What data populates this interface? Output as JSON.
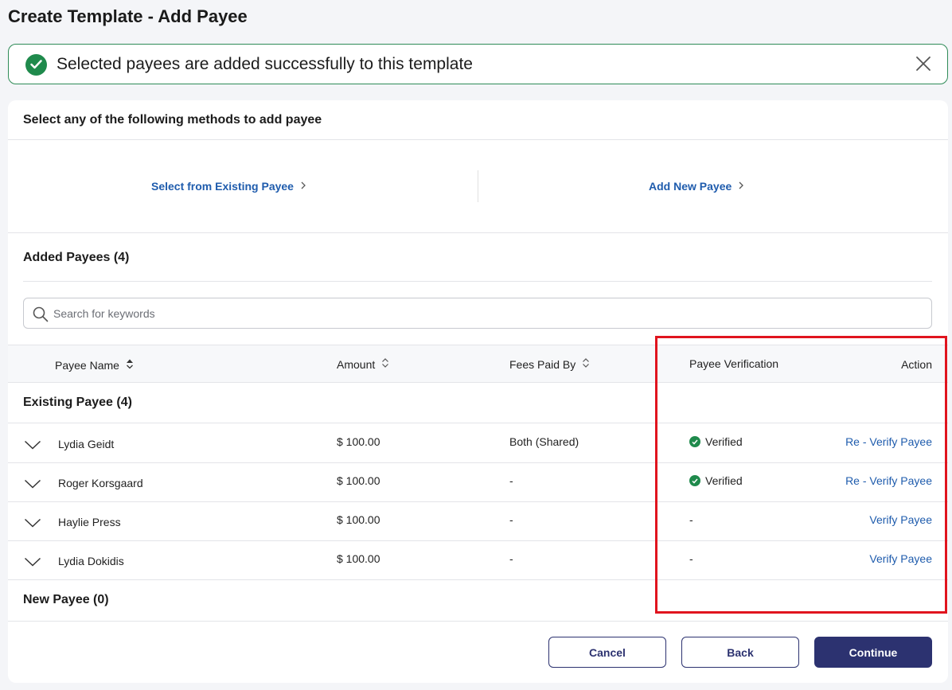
{
  "page": {
    "title": "Create Template - Add Payee"
  },
  "banner": {
    "message": "Selected payees are added successfully to this template"
  },
  "methods": {
    "title": "Select any of the following methods to add payee",
    "existing_label": "Select from Existing Payee",
    "new_label": "Add New Payee"
  },
  "added": {
    "title": "Added Payees (4)",
    "search_placeholder": "Search for keywords"
  },
  "table": {
    "headers": {
      "name": "Payee Name",
      "amount": "Amount",
      "fees": "Fees Paid By",
      "verification": "Payee Verification",
      "action": "Action"
    },
    "existing_group": "Existing Payee (4)",
    "new_group": "New Payee (0)",
    "rows": [
      {
        "name": "Lydia Geidt",
        "amount": "$ 100.00",
        "fees": "Both (Shared)",
        "verification": "Verified",
        "action": "Re - Verify Payee"
      },
      {
        "name": "Roger Korsgaard",
        "amount": "$ 100.00",
        "fees": "-",
        "verification": "Verified",
        "action": "Re - Verify Payee"
      },
      {
        "name": "Haylie Press",
        "amount": "$ 100.00",
        "fees": "-",
        "verification": "-",
        "action": "Verify Payee"
      },
      {
        "name": "Lydia Dokidis",
        "amount": "$ 100.00",
        "fees": "-",
        "verification": "-",
        "action": "Verify Payee"
      }
    ]
  },
  "buttons": {
    "cancel": "Cancel",
    "back": "Back",
    "continue": "Continue"
  },
  "colors": {
    "accent": "#2c3270",
    "link": "#1f5cad",
    "success": "#1f8a4c",
    "highlight": "#e0141e"
  }
}
